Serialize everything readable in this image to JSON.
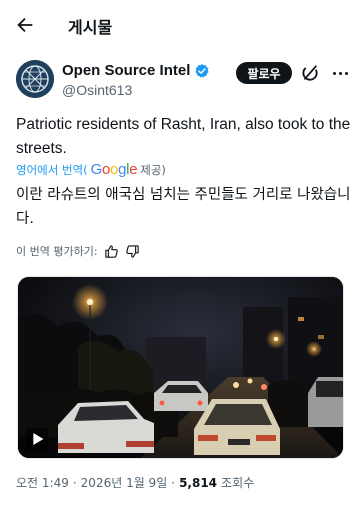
{
  "header": {
    "title": "게시물"
  },
  "author": {
    "name": "Open Source Intel",
    "handle": "@Osint613",
    "follow_label": "팔로우"
  },
  "tweet": {
    "text": "Patriotic residents of Rasht, Iran, also took to the streets.",
    "translate_link": "영어에서 번역(",
    "google": "Google",
    "provided": "제공)",
    "translated_text": "이란 라슈트의 애국심 넘치는 주민들도 거리로 나왔습니다.",
    "rate_label": "이 번역 평가하기:"
  },
  "meta": {
    "time": "오전 1:49",
    "dot1": "·",
    "date": "2026년 1월 9일",
    "dot2": "·",
    "views": "5,814",
    "views_label": "조회수"
  },
  "colors": {
    "accent": "#1d9bf0",
    "text": "#0f1419",
    "muted": "#536471"
  },
  "icons": [
    "back-arrow-icon",
    "verified-badge-icon",
    "grok-icon",
    "more-icon",
    "thumbs-up-icon",
    "thumbs-down-icon",
    "play-icon"
  ]
}
